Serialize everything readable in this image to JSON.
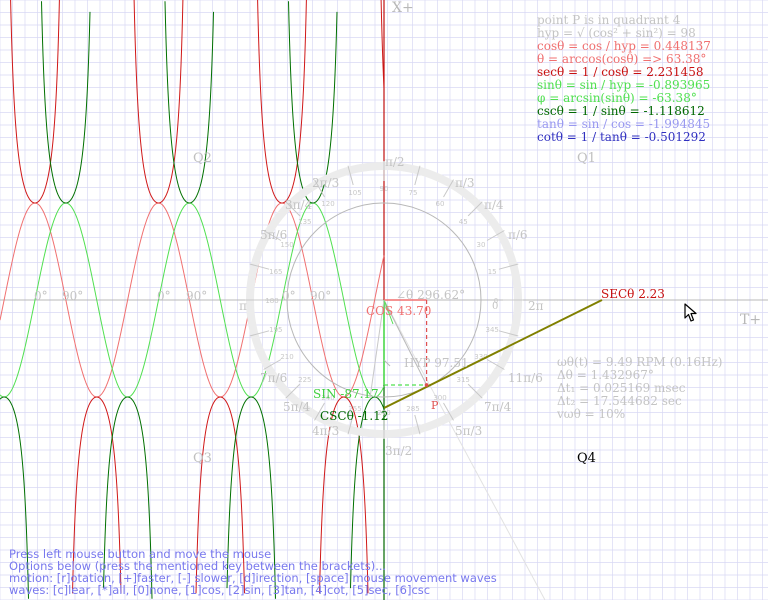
{
  "axes": {
    "x_plus": "X+",
    "t_plus": "T+"
  },
  "quadrants": {
    "q1": "Q1",
    "q2": "Q2",
    "q3": "Q3",
    "q4": "Q4"
  },
  "readout": {
    "quadrant": "point P is in quadrant 4",
    "hyp": "hyp = √ (cos² + sin²) = 98",
    "cos": "cosθ = cos / hyp = 0.448137",
    "theta": "θ = arccos(cosθ) => 63.38°",
    "sec": "secθ = 1 / cosθ = 2.231458",
    "sin": "sinθ = sin / hyp = -0.893965",
    "phi": "φ = arcsin(sinθ) = -63.38°",
    "csc": "cscθ = 1 / sinθ = -1.118612",
    "tan": "tanθ = sin / cos = -1.994845",
    "cot": "cotθ = 1 / tanθ = -0.501292"
  },
  "motion": {
    "rpm": "ωθ(t) = 9.49 RPM (0.16Hz)",
    "dtheta": "Δθ = 1.432967°",
    "dt1": "Δt₁ = 0.025169 msec",
    "dt2": "Δt₂ = 17.544682 sec",
    "vw": "vωθ = 10%"
  },
  "labels": {
    "angle": "∠θ 296.62°",
    "cos": "COS 43.70",
    "sin": "SIN -87.17",
    "hyp": "HYP 97.51",
    "csc": "CSCθ -1.12",
    "sec": "SECθ 2.23",
    "point": "P"
  },
  "radians": [
    "π/2",
    "π/3",
    "π/4",
    "π/6",
    "0",
    "2π",
    "11π/6",
    "7π/4",
    "5π/3",
    "3π/2",
    "4π/3",
    "5π/4",
    "7π/6",
    "π",
    "5π/6",
    "3π/4",
    "2π/3"
  ],
  "degree_ticks": [
    "90",
    "75",
    "60",
    "45",
    "30",
    "15",
    "0",
    "105",
    "120",
    "135",
    "150",
    "165",
    "180",
    "195",
    "210",
    "225",
    "240",
    "255",
    "270",
    "285",
    "300"
  ],
  "wave_marks": {
    "deg0": "0°",
    "deg90": "90°"
  },
  "help": [
    "Press left mouse button and move the mouse",
    "Options below (press the mentioned key between the brackets)...",
    "motion: [r]otation, [+]faster, [-] slower, [d]irection, [space] mouse movement waves",
    "waves: [c]lear, [*]all, [0]none, [1]cos, [2]sin, [3]tan, [4]cot, [5]sec, [6]csc"
  ],
  "colors": {
    "grid": "#d8d8f4",
    "cos": "#f07070",
    "sec": "#d01818",
    "sin": "#50e050",
    "csc": "#007000",
    "tan": "#9898f0",
    "cot": "#3030c0",
    "help": "#7878ee",
    "readout_gray": "#c0c0c0"
  }
}
